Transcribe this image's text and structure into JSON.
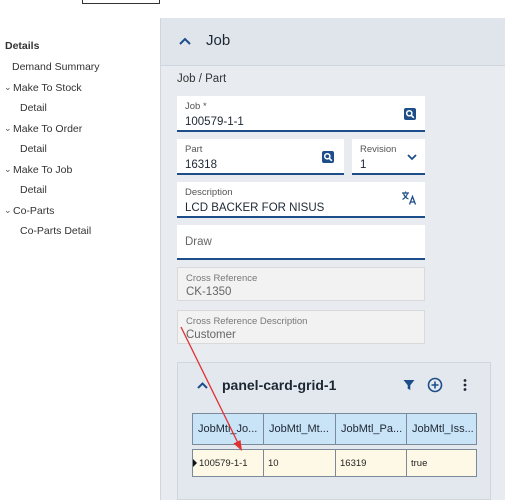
{
  "tree": {
    "items": [
      {
        "label": "Details",
        "bold": true
      },
      {
        "label": "Demand Summary"
      },
      {
        "label": "Make To Stock"
      },
      {
        "label": "Detail"
      },
      {
        "label": "Make To Order"
      },
      {
        "label": "Detail"
      },
      {
        "label": "Make To Job"
      },
      {
        "label": "Detail"
      },
      {
        "label": "Co-Parts"
      },
      {
        "label": "Co-Parts Detail"
      }
    ]
  },
  "panel": {
    "title": "Job",
    "section": "Job / Part",
    "job": {
      "label": "Job *",
      "value": "100579-1-1"
    },
    "part": {
      "label": "Part",
      "value": "16318"
    },
    "revision": {
      "label": "Revision",
      "value": "1"
    },
    "description": {
      "label": "Description",
      "value": "LCD BACKER FOR NISUS"
    },
    "draw": {
      "placeholder": "Draw"
    },
    "cross_reference": {
      "label": "Cross Reference",
      "value": "CK-1350"
    },
    "cross_reference_description": {
      "label": "Cross Reference Description",
      "value": "Customer"
    }
  },
  "card": {
    "title": "panel-card-grid-1",
    "columns": [
      "JobMtl_Jo...",
      "JobMtl_Mt...",
      "JobMtl_Pa...",
      "JobMtl_Iss..."
    ],
    "rows": [
      [
        "100579-1-1",
        "10",
        "16319",
        "true"
      ]
    ]
  },
  "colors": {
    "accent": "#1d4e89",
    "annotation_arrow": "#e03030",
    "grid_header": "#c9e3f7",
    "grid_row": "#fdf9e6"
  }
}
